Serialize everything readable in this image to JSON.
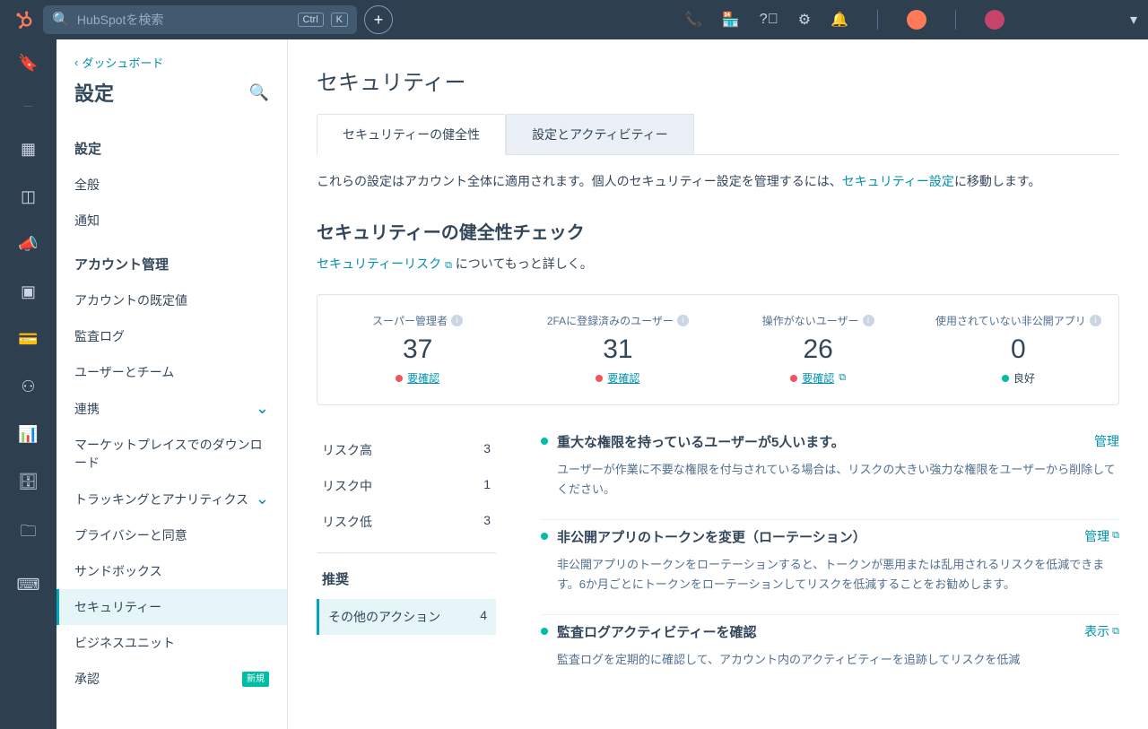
{
  "search": {
    "placeholder": "HubSpotを検索",
    "shortcut1": "Ctrl",
    "shortcut2": "K"
  },
  "sidebar": {
    "back": "ダッシュボード",
    "title": "設定",
    "h1": "設定",
    "i1": "全般",
    "i2": "通知",
    "h2": "アカウント管理",
    "i3": "アカウントの既定値",
    "i4": "監査ログ",
    "i5": "ユーザーとチーム",
    "i6": "連携",
    "i7": "マーケットプレイスでのダウンロード",
    "i8": "トラッキングとアナリティクス",
    "i9": "プライバシーと同意",
    "i10": "サンドボックス",
    "i11": "セキュリティー",
    "i12": "ビジネスユニット",
    "i13": "承認",
    "badge_new": "新規"
  },
  "page": {
    "title": "セキュリティー",
    "tab1": "セキュリティーの健全性",
    "tab2": "設定とアクティビティー",
    "intro_a": "これらの設定はアカウント全体に適用されます。個人のセキュリティー設定を管理するには、",
    "intro_link": "セキュリティー設定",
    "intro_b": "に移動します。",
    "section_title": "セキュリティーの健全性チェック",
    "section_link": "セキュリティーリスク",
    "section_tail": " についてもっと詳しく。"
  },
  "stats": [
    {
      "label": "スーパー管理者",
      "value": "37",
      "status": "要確認",
      "statusType": "red",
      "ext": false
    },
    {
      "label": "2FAに登録済みのユーザー",
      "value": "31",
      "status": "要確認",
      "statusType": "red",
      "ext": false
    },
    {
      "label": "操作がないユーザー",
      "value": "26",
      "status": "要確認",
      "statusType": "red",
      "ext": true
    },
    {
      "label": "使用されていない非公開アプリ",
      "value": "0",
      "status": "良好",
      "statusType": "green",
      "ext": false
    }
  ],
  "risks": {
    "high_l": "リスク高",
    "high_v": "3",
    "med_l": "リスク中",
    "med_v": "1",
    "low_l": "リスク低",
    "low_v": "3",
    "rec_h": "推奨",
    "other_l": "その他のアクション",
    "other_v": "4"
  },
  "findings": [
    {
      "title": "重大な権限を持っているユーザーが5人います。",
      "action": "管理",
      "ext": false,
      "desc": "ユーザーが作業に不要な権限を付与されている場合は、リスクの大きい強力な権限をユーザーから削除してください。"
    },
    {
      "title": "非公開アプリのトークンを変更（ローテーション）",
      "action": "管理",
      "ext": true,
      "desc": "非公開アプリのトークンをローテーションすると、トークンが悪用または乱用されるリスクを低減できます。6か月ごとにトークンをローテーションしてリスクを低減することをお勧めします。"
    },
    {
      "title": "監査ログアクティビティーを確認",
      "action": "表示",
      "ext": true,
      "desc": "監査ログを定期的に確認して、アカウント内のアクティビティーを追跡してリスクを低減"
    }
  ]
}
